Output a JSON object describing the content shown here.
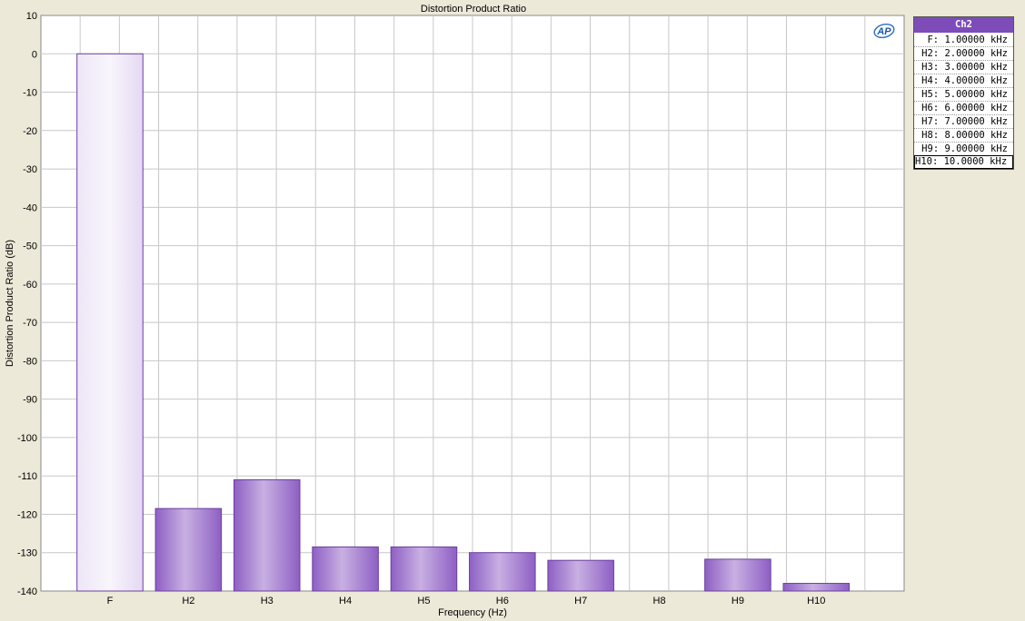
{
  "colors": {
    "bar_edge": "#6a3f9e",
    "bar_light": "#ede6f7",
    "bar_dark": "#8e5fc4",
    "legend_header": "#7e4cb8",
    "grid": "#c8c8c8",
    "plot_bg": "#ffffff",
    "window_bg": "#ece9d8"
  },
  "logo_text": "AP",
  "legend": {
    "header": "Ch2",
    "rows": [
      "F: 1.00000 kHz",
      "H2: 2.00000 kHz",
      "H3: 3.00000 kHz",
      "H4: 4.00000 kHz",
      "H5: 5.00000 kHz",
      "H6: 6.00000 kHz",
      "H7: 7.00000 kHz",
      "H8: 8.00000 kHz",
      "H9: 9.00000 kHz",
      "H10: 10.0000 kHz"
    ]
  },
  "chart_data": {
    "type": "bar",
    "title": "Distortion Product Ratio",
    "xlabel": "Frequency (Hz)",
    "ylabel": "Distortion Product Ratio (dB)",
    "ylim": [
      -140,
      10
    ],
    "yticks": [
      10,
      0,
      -10,
      -20,
      -30,
      -40,
      -50,
      -60,
      -70,
      -80,
      -90,
      -100,
      -110,
      -120,
      -130,
      -140
    ],
    "grid": true,
    "categories": [
      "F",
      "H2",
      "H3",
      "H4",
      "H5",
      "H6",
      "H7",
      "H8",
      "H9",
      "H10"
    ],
    "values": [
      0,
      -118.5,
      -111,
      -128.5,
      -128.5,
      -130,
      -132,
      null,
      -131.7,
      -138
    ]
  }
}
